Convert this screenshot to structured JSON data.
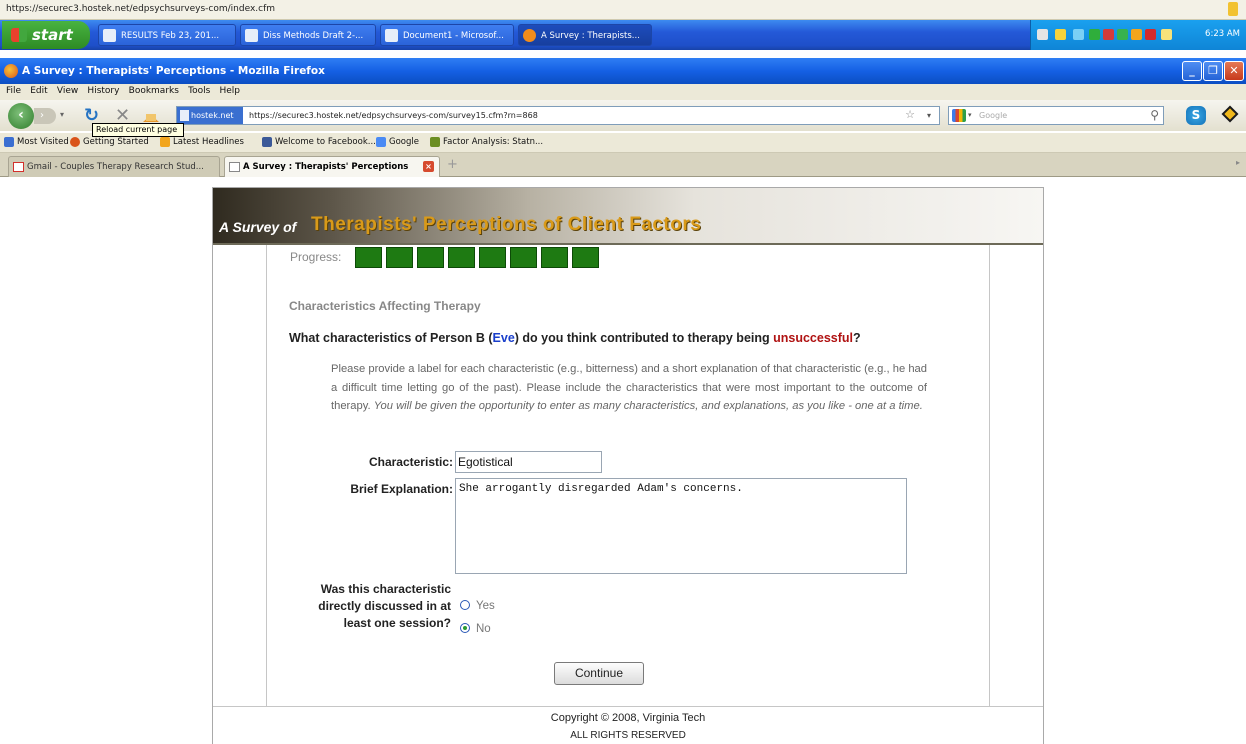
{
  "status_strip": {
    "url": "https://securec3.hostek.net/edpsychsurveys-com/index.cfm"
  },
  "taskbar": {
    "start_label": "start",
    "tasks": [
      {
        "label": "RESULTS Feb 23, 201..."
      },
      {
        "label": "Diss Methods Draft 2-..."
      },
      {
        "label": "Document1 - Microsof..."
      },
      {
        "label": "A Survey : Therapists..."
      }
    ],
    "clock": "6:23 AM"
  },
  "window": {
    "title": "A Survey : Therapists' Perceptions - Mozilla Firefox"
  },
  "menu": [
    "File",
    "Edit",
    "View",
    "History",
    "Bookmarks",
    "Tools",
    "Help"
  ],
  "navbar": {
    "site_identity": "hostek.net",
    "url": "https://securec3.hostek.net/edpsychsurveys-com/survey15.cfm?rn=868",
    "search_placeholder": "Google",
    "tooltip": "Reload current page"
  },
  "bookmarks": [
    {
      "label": "Most Visited",
      "color": "#3b6fd1"
    },
    {
      "label": "Getting Started",
      "color": "#d9541a"
    },
    {
      "label": "Latest Headlines",
      "color": "#f2a51c"
    },
    {
      "label": "Welcome to Facebook...",
      "color": "#3b5998"
    },
    {
      "label": "Google",
      "color": "#4a8af4"
    },
    {
      "label": "Factor Analysis: Statn...",
      "color": "#6b8e23"
    }
  ],
  "tabs": [
    {
      "label": "Gmail - Couples Therapy Research Stud...",
      "active": false
    },
    {
      "label": "A Survey : Therapists' Perceptions",
      "active": true
    }
  ],
  "survey": {
    "banner_prefix": "A Survey of",
    "banner_title": "Therapists' Perceptions of Client Factors",
    "progress_label": "Progress:",
    "section_heading": "Characteristics Affecting Therapy",
    "question_pre": "What characteristics of Person B (",
    "question_person": "Eve",
    "question_mid": ") do you think contributed to therapy being ",
    "question_outcome": "unsuccessful",
    "question_end": "?",
    "instructions_main": "Please provide a label for each characteristic (e.g., bitterness) and a short explanation of that characteristic (e.g., he had a difficult time letting go of the past). Please include the characteristics that were most important to the outcome of therapy. ",
    "instructions_italic": "You will be given the opportunity to enter as many characteristics, and explanations, as you like - one at a time.",
    "characteristic_label": "Characteristic:",
    "characteristic_value": "Egotistical",
    "explanation_label": "Brief Explanation:",
    "explanation_value": "She arrogantly disregarded Adam's concerns.",
    "discussed_label": "Was this characteristic directly discussed in at least one session?",
    "option_yes": "Yes",
    "option_no": "No",
    "selected_option": "No",
    "continue_label": "Continue",
    "copyright": "Copyright © 2008, Virginia Tech",
    "rights": "ALL RIGHTS RESERVED"
  }
}
